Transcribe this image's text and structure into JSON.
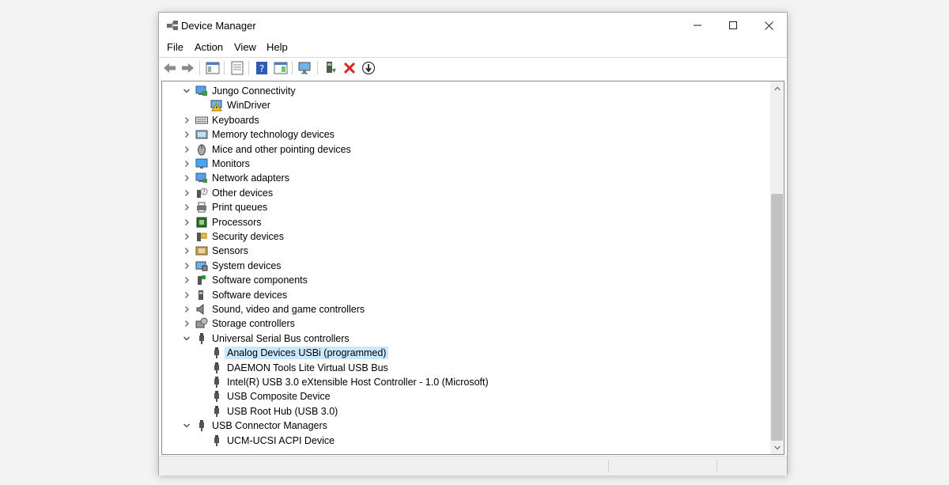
{
  "window": {
    "title": "Device Manager",
    "controls": {
      "minimize": "—",
      "maximize": "☐",
      "close": "✕"
    }
  },
  "menu": [
    "File",
    "Action",
    "View",
    "Help"
  ],
  "toolbar": {
    "buttons": [
      "back-icon",
      "forward-icon",
      "show-hide-console-tree-icon",
      "properties-icon",
      "help-icon",
      "action-pane-icon",
      "scan-hardware-icon",
      "update-driver-icon",
      "uninstall-icon",
      "disable-device-icon"
    ]
  },
  "tree": {
    "items": [
      {
        "label": "Jungo Connectivity",
        "level": 0,
        "expanded": true,
        "icon": "network-computer-icon"
      },
      {
        "label": "WinDriver",
        "level": 1,
        "icon": "windriver-warning-icon"
      },
      {
        "label": "Keyboards",
        "level": 0,
        "expanded": false,
        "icon": "keyboard-icon"
      },
      {
        "label": "Memory technology devices",
        "level": 0,
        "expanded": false,
        "icon": "memory-device-icon"
      },
      {
        "label": "Mice and other pointing devices",
        "level": 0,
        "expanded": false,
        "icon": "mouse-icon"
      },
      {
        "label": "Monitors",
        "level": 0,
        "expanded": false,
        "icon": "monitor-icon"
      },
      {
        "label": "Network adapters",
        "level": 0,
        "expanded": false,
        "icon": "network-adapter-icon"
      },
      {
        "label": "Other devices",
        "level": 0,
        "expanded": false,
        "icon": "unknown-device-icon"
      },
      {
        "label": "Print queues",
        "level": 0,
        "expanded": false,
        "icon": "printer-icon"
      },
      {
        "label": "Processors",
        "level": 0,
        "expanded": false,
        "icon": "processor-icon"
      },
      {
        "label": "Security devices",
        "level": 0,
        "expanded": false,
        "icon": "security-device-icon"
      },
      {
        "label": "Sensors",
        "level": 0,
        "expanded": false,
        "icon": "sensor-icon"
      },
      {
        "label": "System devices",
        "level": 0,
        "expanded": false,
        "icon": "system-device-icon"
      },
      {
        "label": "Software components",
        "level": 0,
        "expanded": false,
        "icon": "software-component-icon"
      },
      {
        "label": "Software devices",
        "level": 0,
        "expanded": false,
        "icon": "software-device-icon"
      },
      {
        "label": "Sound, video and game controllers",
        "level": 0,
        "expanded": false,
        "icon": "speaker-icon"
      },
      {
        "label": "Storage controllers",
        "level": 0,
        "expanded": false,
        "icon": "storage-controller-icon"
      },
      {
        "label": "Universal Serial Bus controllers",
        "level": 0,
        "expanded": true,
        "icon": "usb-icon"
      },
      {
        "label": "Analog Devices USBi (programmed)",
        "level": 1,
        "selected": true,
        "icon": "usb-icon"
      },
      {
        "label": "DAEMON Tools Lite Virtual USB Bus",
        "level": 1,
        "icon": "usb-icon"
      },
      {
        "label": "Intel(R) USB 3.0 eXtensible Host Controller - 1.0 (Microsoft)",
        "level": 1,
        "icon": "usb-icon"
      },
      {
        "label": "USB Composite Device",
        "level": 1,
        "icon": "usb-icon"
      },
      {
        "label": "USB Root Hub (USB 3.0)",
        "level": 1,
        "icon": "usb-icon"
      },
      {
        "label": "USB Connector Managers",
        "level": 0,
        "expanded": true,
        "icon": "usb-icon"
      },
      {
        "label": "UCM-UCSI ACPI Device",
        "level": 1,
        "icon": "usb-icon"
      }
    ]
  },
  "colors": {
    "selection": "#cce8ff",
    "window_border": "#a8a8a8",
    "scroll_thumb": "#c2c2c2"
  }
}
